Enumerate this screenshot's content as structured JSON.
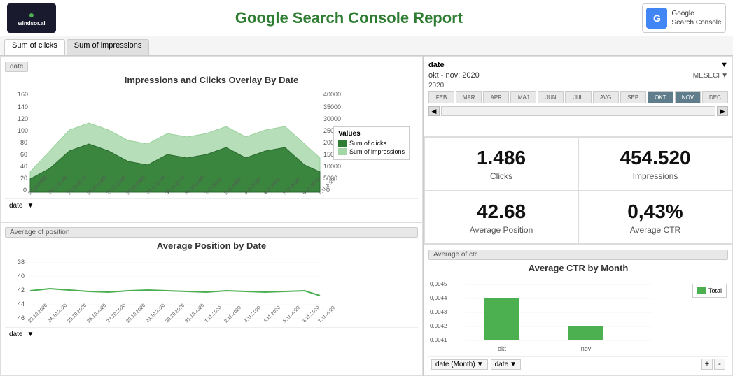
{
  "header": {
    "title": "Google Search Console Report",
    "logo_windsor": "windsor.ai",
    "logo_google": "Google",
    "logo_google_sub": "Search Console"
  },
  "tabs": [
    {
      "label": "Sum of clicks",
      "active": true
    },
    {
      "label": "Sum of impressions",
      "active": false
    }
  ],
  "left_top_chart": {
    "title": "Impressions and Clicks Overlay By Date",
    "section_label": "date",
    "legend_title": "Values",
    "legend_items": [
      {
        "label": "Sum of clicks",
        "color": "#2e7d32"
      },
      {
        "label": "Sum of impressions",
        "color": "#a5d6a7"
      }
    ],
    "y_axis_left": [
      "160",
      "140",
      "120",
      "100",
      "80",
      "60",
      "40",
      "20",
      "0"
    ],
    "y_axis_right": [
      "40000",
      "35000",
      "30000",
      "25000",
      "20000",
      "15000",
      "10000",
      "5000",
      "0"
    ],
    "x_labels": [
      "23.10.2020",
      "24.10.2020",
      "25.10.2020",
      "26.10.2020",
      "27.10.2020",
      "28.10.2020",
      "29.10.2020",
      "30.10.2020",
      "31.10.2020",
      "1.11.2020",
      "2.11.2020",
      "3.11.2020",
      "4.11.2020",
      "5.11.2020",
      "6.11.2020",
      "7.11.2020"
    ]
  },
  "stats": {
    "clicks": {
      "value": "1.486",
      "label": "Clicks"
    },
    "impressions": {
      "value": "454.520",
      "label": "Impressions"
    },
    "avg_position": {
      "value": "42.68",
      "label": "Average Position"
    },
    "avg_ctr": {
      "value": "0,43%",
      "label": "Average CTR"
    }
  },
  "date_filter": {
    "label": "date",
    "range": "okt - nov: 2020",
    "meseci": "MESECI",
    "year": "2020",
    "months": [
      "FEB",
      "MAR",
      "APR",
      "MAJ",
      "JUN",
      "JUL",
      "AVG",
      "SEP",
      "OKT",
      "NOV",
      "DEC"
    ],
    "selected_months": [
      "OKT",
      "NOV"
    ]
  },
  "bottom_left_chart": {
    "title": "Average Position by Date",
    "section_label": "Average of position",
    "y_axis": [
      "38",
      "40",
      "42",
      "44",
      "46"
    ],
    "x_labels": [
      "23.10.2020",
      "24.10.2020",
      "25.10.2020",
      "26.10.2020",
      "27.10.2020",
      "28.10.2020",
      "29.10.2020",
      "30.10.2020",
      "31.10.2020",
      "1.11.2020",
      "2.11.2020",
      "3.11.2020",
      "4.11.2020",
      "5.11.2020",
      "6.11.2020",
      "7.11.2020"
    ]
  },
  "bottom_right_chart": {
    "title": "Average CTR by Month",
    "section_label": "Average of ctr",
    "legend_label": "Total",
    "y_axis": [
      "0,0045",
      "0,0044",
      "0,0043",
      "0,0042",
      "0,0041"
    ],
    "x_labels": [
      "okt",
      "nov"
    ],
    "bar_values": [
      0.0044,
      0.0042
    ],
    "filter1": "date (Month)",
    "filter2": "date"
  },
  "date_filter_bar": {
    "label": "date"
  }
}
